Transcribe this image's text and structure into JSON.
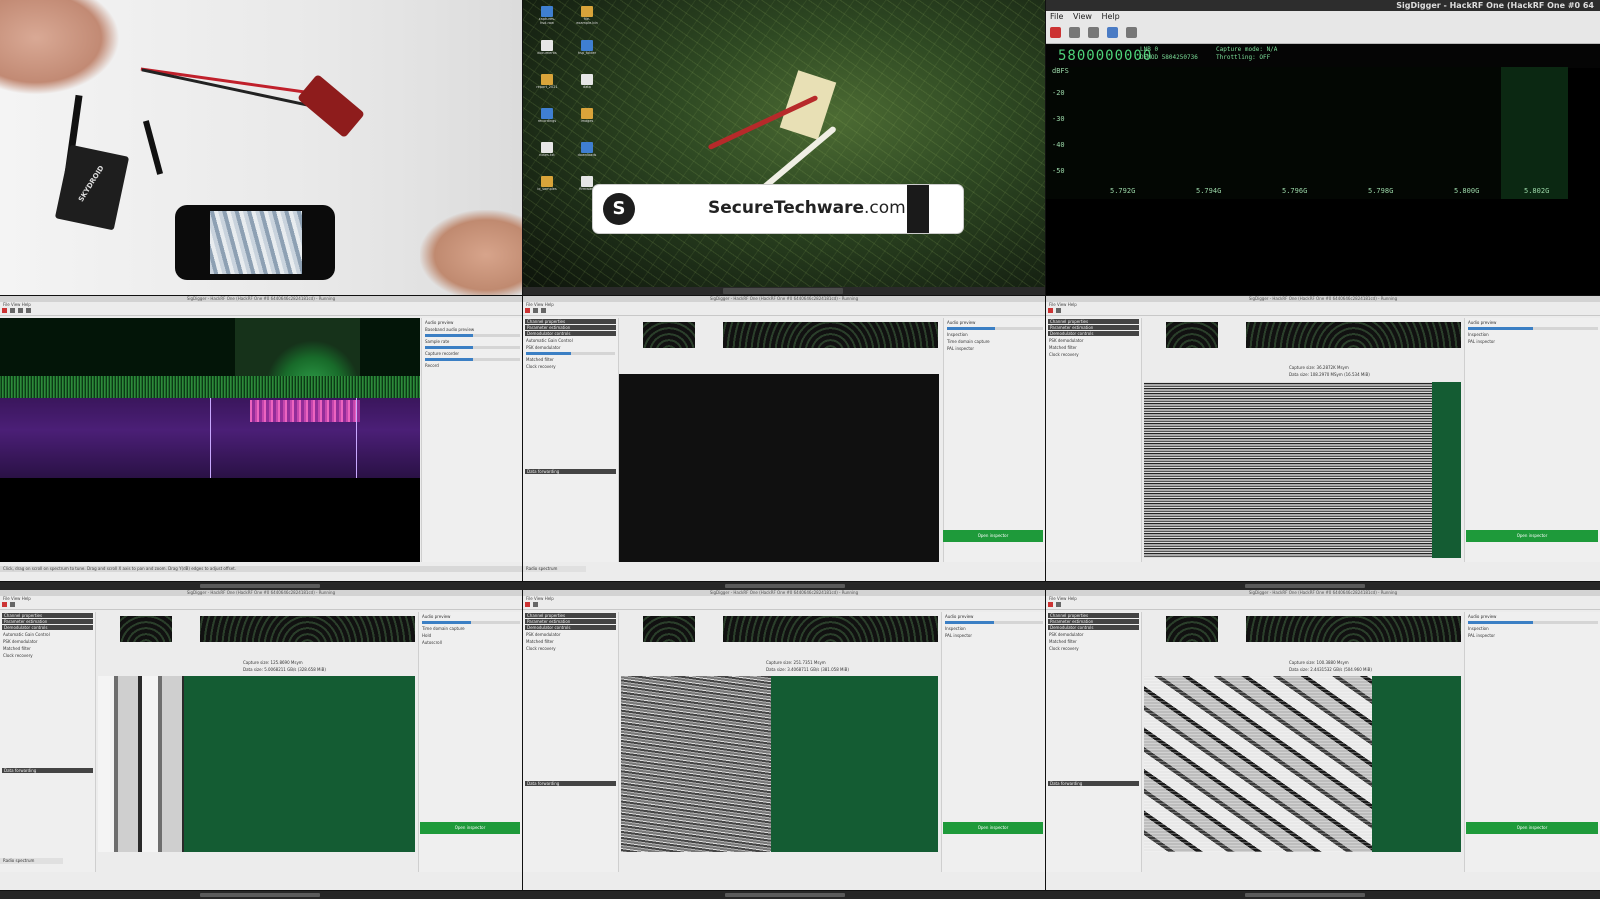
{
  "desktop_tile": {
    "banner_brand_bold": "SecureTechware",
    "banner_brand_suffix": ".com",
    "logo_glyph": "S",
    "icons": [
      {
        "label": "captures-hsd.raw"
      },
      {
        "label": "file-example.bin"
      },
      {
        "label": "documents"
      },
      {
        "label": "hsp_folder"
      },
      {
        "label": "report_2021"
      },
      {
        "label": "data"
      },
      {
        "label": "recordings"
      },
      {
        "label": "images"
      },
      {
        "label": "notes.txt"
      },
      {
        "label": "downloads"
      },
      {
        "label": "iq_samples"
      },
      {
        "label": "firmware"
      }
    ]
  },
  "main_window": {
    "title": "SigDigger - HackRF One (HackRF One #0 64",
    "menu": [
      "File",
      "View",
      "Help"
    ],
    "frequency": "5800000000",
    "lnb_label": "LNB",
    "lnb_value": "0",
    "demod_label": "DEMOD",
    "demod_value": "5804250736",
    "capture_mode": "Capture mode: N/A",
    "throttling": "Throttling: OFF",
    "y_unit": "dBFS",
    "y_ticks": [
      "-20",
      "-30",
      "-40",
      "-50"
    ],
    "x_ticks": [
      "5.792G",
      "5.794G",
      "5.796G",
      "5.798G",
      "5.800G",
      "5.802G"
    ]
  },
  "window_title_small": "SigDigger - HackRF One (HackRF One #0 6440646c2824181cd) - Running",
  "small_labels": {
    "menu": "File  View  Help",
    "radio_spectrum": "Radio spectrum",
    "pal_inspector": "PAL inspector",
    "open_inspector": "Open inspector",
    "data_forwarding": "Data forwarding",
    "channel_properties": "Channel properties",
    "parameter_estimation": "Parameter estimation",
    "demodulator_controls": "Demodulator controls",
    "audio_preview": "Audio preview",
    "baseband_audio_preview": "Baseband audio preview",
    "automatic_gain_control": "Automatic Gain Control",
    "psk_demodulator": "PSK demodulator",
    "matched_filter": "Matched filter",
    "clock_recovery": "Clock recovery",
    "time_domain_capture": "Time domain capture",
    "inspection": "Inspection",
    "sample_rate": "Sample rate",
    "capture_recorder": "Capture recorder",
    "record": "Record",
    "hold": "Hold",
    "autoscroll": "Autoscroll"
  },
  "captures": [
    {
      "size_label": "Capture size: 36.2872K Msym",
      "data_size": "Data size: 108.2970 MSym (16.534 MiB)"
    },
    {
      "size_label": "Capture size: 125.8690 Msym",
      "data_size": "Data size: 5.0068211 GB/s (328.658 MiB)"
    },
    {
      "size_label": "Capture size: 251.7351 Msym",
      "data_size": "Data size: 3.4068711 GB/s (381.058 MiB)"
    },
    {
      "size_label": "Capture size: 100.3880 Msym",
      "data_size": "Data size: 2.4431532 GB/s (504.960 MiB)"
    }
  ],
  "status_hint": "Click, drag on scroll on spectrum to tune. Drag and scroll X axis to pan and zoom. Drag Y(dB) edges to adjust offset.",
  "colors": {
    "freq_green": "#4ed37a",
    "open_inspector_green": "#1e9a3a",
    "record_red": "#c33333",
    "waterfall_purple": "#4b1f77"
  }
}
